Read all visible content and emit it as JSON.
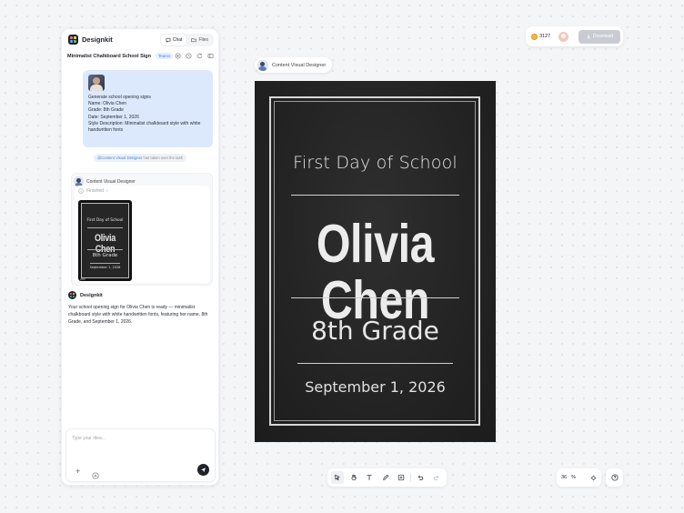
{
  "app": {
    "name": "Designkit",
    "tabs": [
      {
        "label": "Chat",
        "icon": "chat-icon",
        "active": true
      },
      {
        "label": "Files",
        "icon": "folder-icon",
        "active": false
      }
    ]
  },
  "project": {
    "title": "Minimalist Chalkboard School Sign",
    "badge": "Teams"
  },
  "user_message": {
    "lines": [
      "Generate school opening signs",
      "Name: Olivia Chen",
      "Grade: 8th Grade",
      "Date: September 1, 2026",
      "Style Description: Minimalist chalkboard style with white handwritten fonts"
    ]
  },
  "handoff": {
    "agent": "@Content Visual Designer",
    "text": " has taken over the task"
  },
  "agent_card": {
    "name": "Content Visual Designer",
    "status": "Finished"
  },
  "reply": {
    "name": "Designkit",
    "text": "Your school opening sign for Olivia Chen is ready — minimalist chalkboard style with white handwritten fonts, featuring her name, 8th Grade, and September 1, 2026."
  },
  "input": {
    "placeholder": "Type your idea..."
  },
  "top_bar": {
    "credits": "3127",
    "download_label": "Download"
  },
  "canvas": {
    "frame_label": "Content Visual Designer",
    "sign": {
      "title": "First Day of School",
      "name": "Olivia Chen",
      "grade": "8th Grade",
      "date": "September 1, 2026"
    }
  },
  "zoom": {
    "value": "36",
    "unit": "%"
  },
  "colors": {
    "accent": "#3b82f6",
    "user_bubble": "#dce9fc",
    "chalkboard": "#262626",
    "send_button": "#1f2329"
  }
}
